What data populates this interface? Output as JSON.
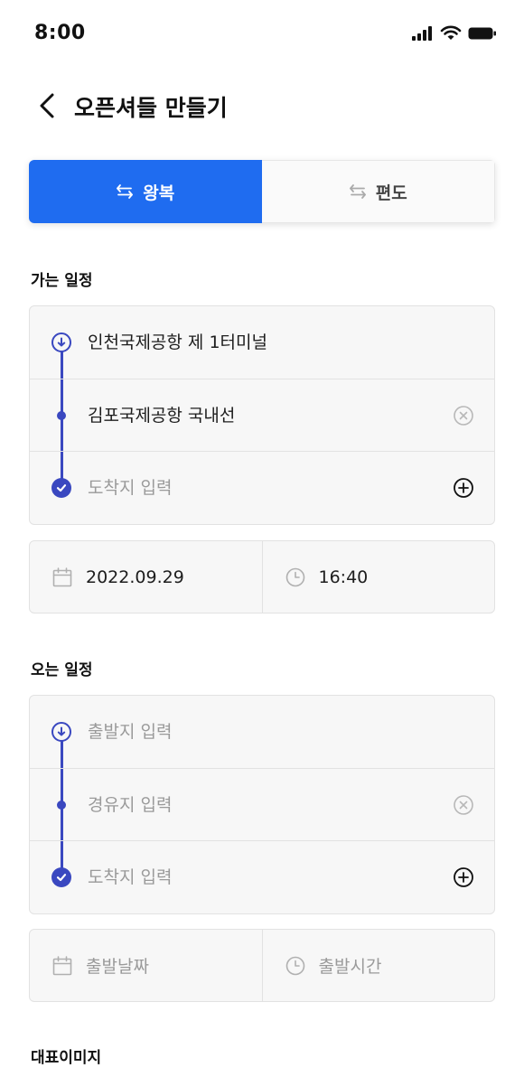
{
  "status_bar": {
    "time": "8:00"
  },
  "header": {
    "title": "오픈셔들 만들기"
  },
  "trip_type": {
    "round_trip_label": "왕복",
    "one_way_label": "편도",
    "selected": "round_trip"
  },
  "outbound": {
    "section_title": "가는 일정",
    "departure": "인천국제공항 제 1터미널",
    "waypoint": "김포국제공항 국내선",
    "destination_placeholder": "도착지 입력",
    "date": "2022.09.29",
    "time": "16:40"
  },
  "inbound": {
    "section_title": "오는 일정",
    "departure_placeholder": "출발지 입력",
    "waypoint_placeholder": "경유지 입력",
    "destination_placeholder": "도착지 입력",
    "date_placeholder": "출발날짜",
    "time_placeholder": "출발시간"
  },
  "image_section": {
    "title": "대표이미지"
  },
  "colors": {
    "primary": "#1f6cf0",
    "route": "#3a48c0",
    "placeholder": "#9a9a9a",
    "box_bg": "#f7f7f7",
    "border": "#e2e2e2"
  },
  "icons": {
    "back": "chevron-left-icon",
    "swap": "swap-arrows-icon",
    "calendar": "calendar-icon",
    "clock": "clock-icon",
    "remove": "clear-circle-icon",
    "add": "add-circle-icon",
    "start_marker": "arrow-down-circle-icon",
    "end_marker": "check-circle-icon"
  }
}
